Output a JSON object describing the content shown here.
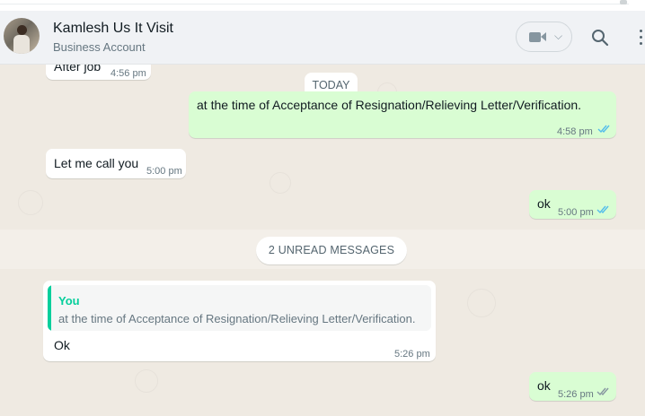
{
  "header": {
    "contact_name": "Kamlesh Us It Visit",
    "contact_subtitle": "Business Account",
    "icons": [
      "avatar",
      "video-call-icon",
      "chevron-down-icon",
      "search-icon",
      "menu-icon"
    ]
  },
  "colors": {
    "incoming_bubble": "#ffffff",
    "outgoing_bubble": "#d9fdd3",
    "chat_bg": "#efeae2",
    "read_ticks": "#53bdeb",
    "delivered_ticks": "#8696a0",
    "quote_accent": "#06cf9c"
  },
  "chat": {
    "today_label": "TODAY",
    "unread_label": "2 UNREAD MESSAGES",
    "messages": [
      {
        "direction": "in",
        "text": "After job",
        "time": "4:56 pm"
      },
      {
        "direction": "out",
        "text": "at the time of Acceptance of Resignation/Relieving Letter/Verification.",
        "time": "4:58 pm",
        "status": "read"
      },
      {
        "direction": "in",
        "text": "Let me call you",
        "time": "5:00 pm"
      },
      {
        "direction": "out",
        "text": "ok",
        "time": "5:00 pm",
        "status": "read"
      },
      {
        "direction": "in",
        "quote_author": "You",
        "quote_text": "at the time of Acceptance of Resignation/Relieving Letter/Verification.",
        "text": "Ok",
        "time": "5:26 pm"
      },
      {
        "direction": "out",
        "text": "ok",
        "time": "5:26 pm",
        "status": "delivered"
      }
    ]
  }
}
